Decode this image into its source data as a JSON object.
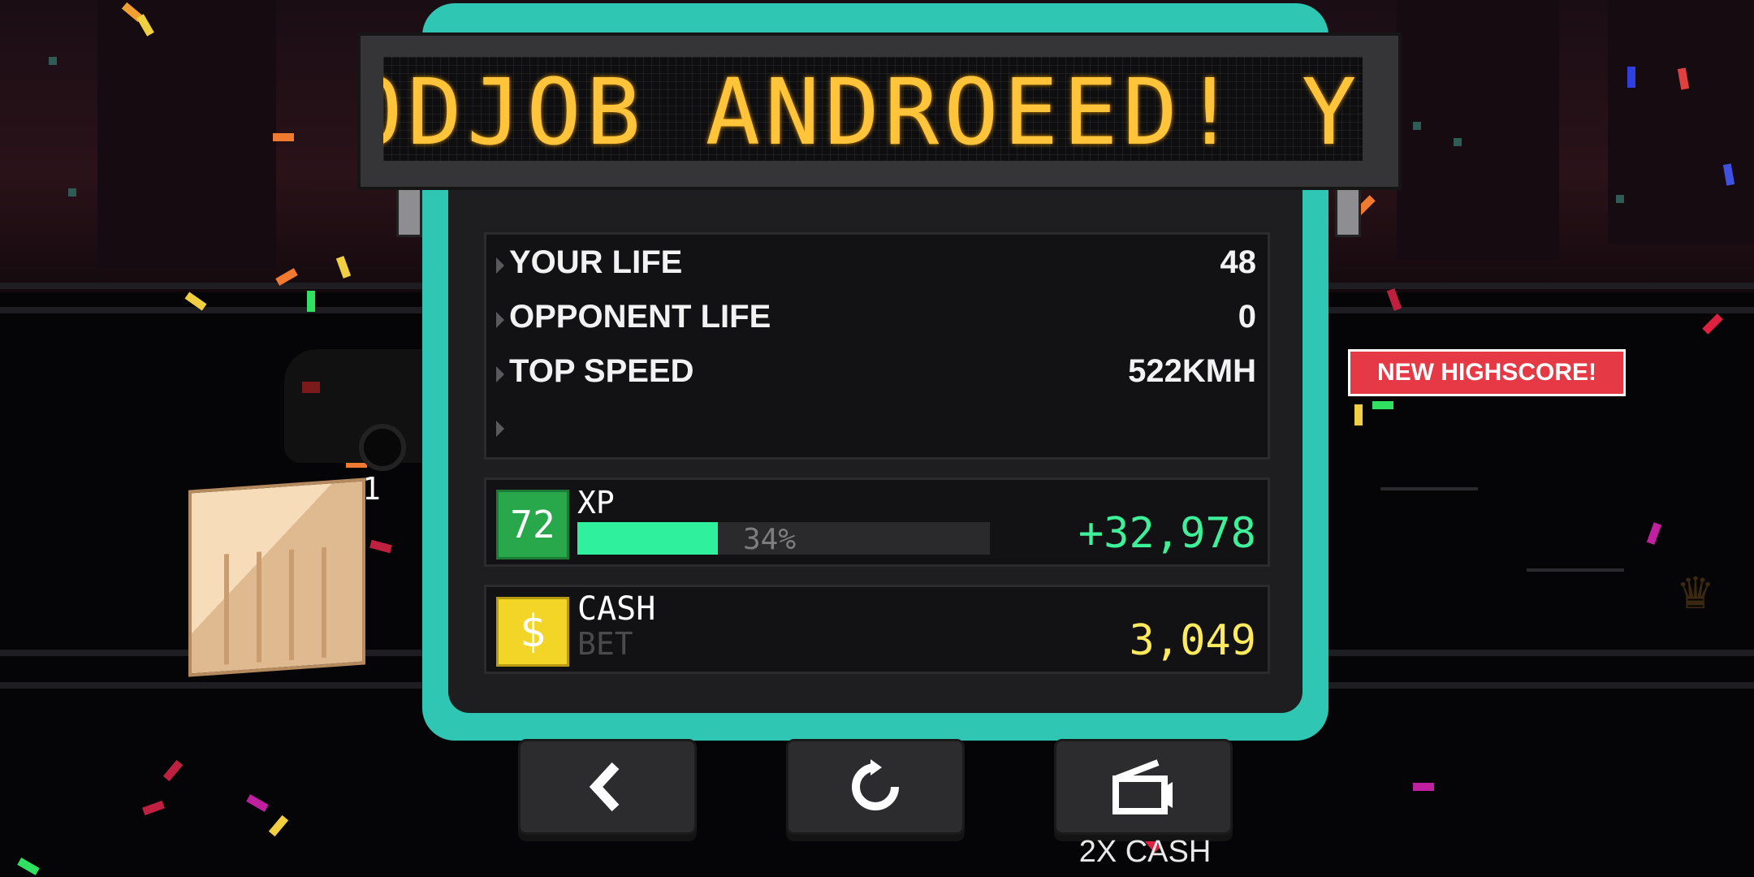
{
  "ticker": {
    "text": "ODJOB ANDROEED! YC"
  },
  "stats": {
    "rows": [
      {
        "label": "YOUR LIFE",
        "value": "48"
      },
      {
        "label": "OPPONENT LIFE",
        "value": "0"
      },
      {
        "label": "TOP SPEED",
        "value": "522KMH"
      },
      {
        "label": "",
        "value": ""
      }
    ]
  },
  "xp": {
    "level": "72",
    "label": "XP",
    "progress_percent": 34,
    "progress_text": "34%",
    "gained": "+32,978"
  },
  "cash": {
    "label": "CASH",
    "sublabel": "BET",
    "coin_symbol": "$",
    "amount": "3,049"
  },
  "badge": {
    "highscore": "NEW HIGHSCORE!"
  },
  "world": {
    "crate_number": "1"
  },
  "buttons": {
    "back_icon": "chevron-left-icon",
    "retry_icon": "retry-icon",
    "double_cash_icon": "video-ad-icon",
    "double_cash_label": "2X CASH"
  },
  "colors": {
    "panel": "#2fc7b4",
    "xp_green": "#3ef09a",
    "cash_yellow": "#ffe95c",
    "ticker_amber": "#ffc43a",
    "highscore_red": "#e53a45"
  }
}
